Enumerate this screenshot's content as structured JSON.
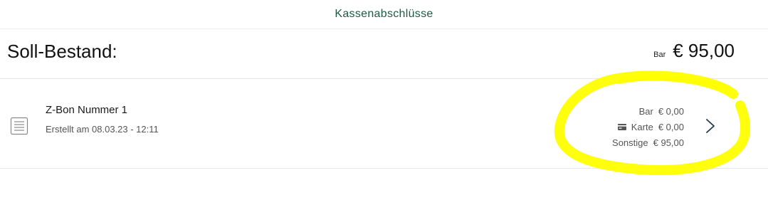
{
  "header": {
    "title": "Kassenabschlüsse"
  },
  "summary": {
    "label": "Soll-Bestand:",
    "method": "Bar",
    "amount": "€ 95,00"
  },
  "entries": [
    {
      "title": "Z-Bon Nummer 1",
      "subtitle": "Erstellt am 08.03.23 - 12:11",
      "icon": "document-icon",
      "breakdown": [
        {
          "label": "Bar",
          "amount": "€ 0,00",
          "icon": ""
        },
        {
          "label": "Karte",
          "amount": "€ 0,00",
          "icon": "credit-card-icon"
        },
        {
          "label": "Sonstige",
          "amount": "€ 95,00",
          "icon": ""
        }
      ]
    }
  ],
  "colors": {
    "header_title": "#1e5a45",
    "chevron": "#1e3a4c",
    "highlight": "#ffff00"
  }
}
